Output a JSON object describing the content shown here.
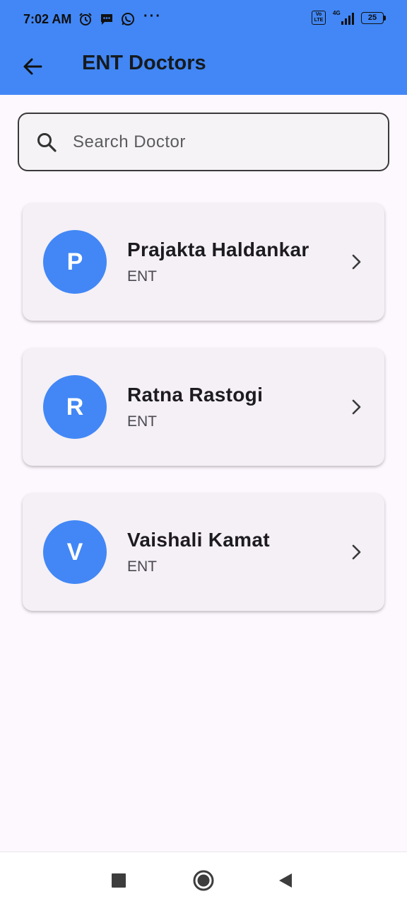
{
  "status_bar": {
    "time": "7:02 AM",
    "left_icons": [
      "alarm-icon",
      "message-icon",
      "whatsapp-icon"
    ],
    "overflow": "···",
    "volte_label": "Vo LTE",
    "network_label": "4G",
    "battery": "25"
  },
  "app_bar": {
    "title": "ENT Doctors",
    "back_icon": "arrow-back-icon",
    "background_color": "#4287F5"
  },
  "search": {
    "placeholder": "Search Doctor",
    "value": "",
    "icon": "search-icon"
  },
  "doctors": [
    {
      "initial": "P",
      "name": "Prajakta Haldankar",
      "specialty": "ENT"
    },
    {
      "initial": "R",
      "name": "Ratna Rastogi",
      "specialty": "ENT"
    },
    {
      "initial": "V",
      "name": "Vaishali Kamat",
      "specialty": "ENT"
    }
  ],
  "colors": {
    "accent": "#4287F5",
    "background": "#FDF7FE",
    "card": "#F4F0F6"
  },
  "nav_bar": {
    "buttons": [
      "recents-icon",
      "home-icon",
      "back-triangle-icon"
    ]
  }
}
